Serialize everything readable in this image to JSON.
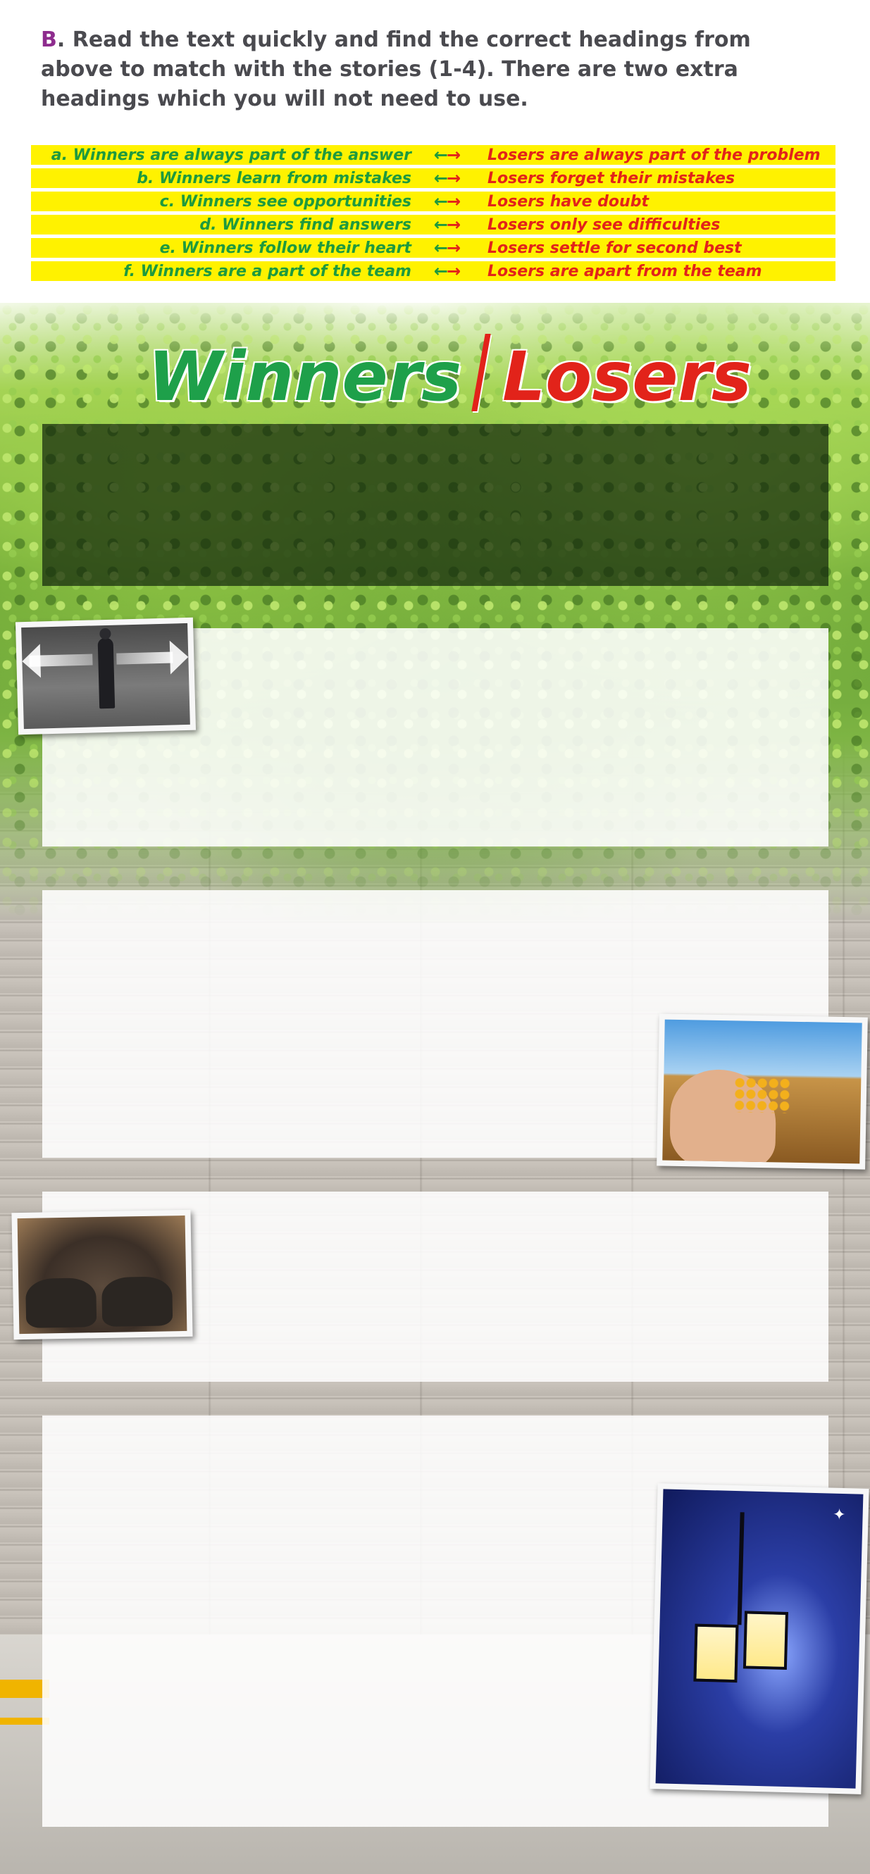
{
  "instruction": {
    "letter": "B",
    "text": ". Read the text quickly and find the correct headings from above to match with the stories (1-4). There are two extra headings which you will not need to use."
  },
  "headings": [
    {
      "winner": "a. Winners are always part of the answer",
      "loser": "Losers are always part of the problem"
    },
    {
      "winner": "b. Winners learn from mistakes",
      "loser": "Losers forget their mistakes"
    },
    {
      "winner": "c. Winners see opportunities",
      "loser": "Losers have doubt"
    },
    {
      "winner": "d. Winners find answers",
      "loser": "Losers only see difficulties"
    },
    {
      "winner": "e. Winners follow their heart",
      "loser": "Losers settle for second best"
    },
    {
      "winner": "f. Winners are a part of the team",
      "loser": "Losers are apart from the team"
    }
  ],
  "arrows": {
    "left": "←",
    "right": "→"
  },
  "title": {
    "winners": "Winners",
    "losers": "Losers"
  },
  "icons": {
    "photo1": "man-with-arrows-photo-icon",
    "photo2": "hand-with-seeds-photo-icon",
    "photo3": "bare-feet-photo-icon",
    "photo4": "street-lamps-photo-icon",
    "star": "✦"
  },
  "colors": {
    "winners_green": "#1ea04a",
    "losers_red": "#e2231a",
    "highlight_yellow": "#fff200",
    "instruction_letter": "#8e2c8e"
  }
}
